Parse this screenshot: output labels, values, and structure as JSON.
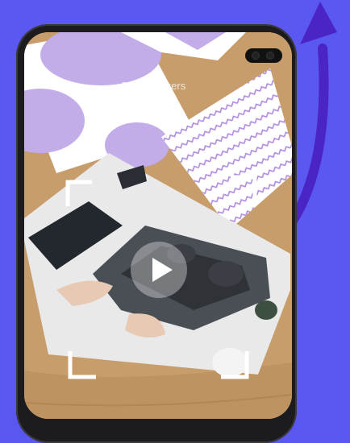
{
  "screen": {
    "title": "Scan Markers"
  },
  "icons": {
    "play": "play-icon",
    "arrow": "curved-arrow-up-icon"
  },
  "colors": {
    "background": "#5b58f1",
    "arrow": "#4a24c4",
    "accent_purple": "#bfa6e6",
    "wood": "#c8a57a"
  }
}
